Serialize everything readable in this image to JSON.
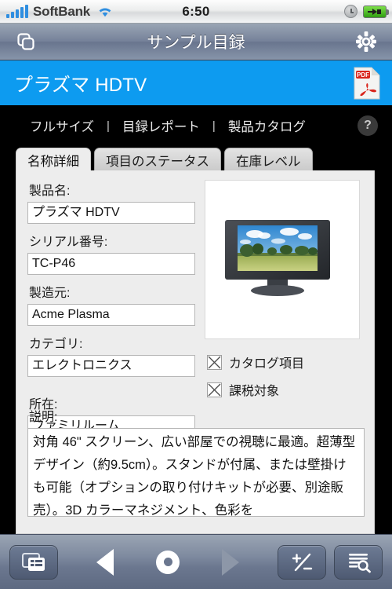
{
  "status_bar": {
    "carrier": "SoftBank",
    "time": "6:50",
    "signal_icon": "signal-bars-icon",
    "wifi_icon": "wifi-icon",
    "alarm_icon": "alarm-clock-icon",
    "battery_icon": "battery-charging-icon"
  },
  "nav_bar": {
    "title": "サンプル目録",
    "left_icon": "layers-copy-icon",
    "right_icon": "gear-icon"
  },
  "record_header": {
    "title": "プラズマ HDTV",
    "pdf_icon": "pdf-document-icon",
    "accent_color": "#0d9bf0"
  },
  "link_toolbar": {
    "links": [
      "フルサイズ",
      "目録レポート",
      "製品カタログ"
    ],
    "separator": "|",
    "help_label": "?"
  },
  "tabs": [
    {
      "label": "名称詳細",
      "active": true
    },
    {
      "label": "項目のステータス",
      "active": false
    },
    {
      "label": "在庫レベル",
      "active": false
    }
  ],
  "form": {
    "fields": [
      {
        "label": "製品名:",
        "value": "プラズマ HDTV"
      },
      {
        "label": "シリアル番号:",
        "value": "TC-P46"
      },
      {
        "label": "製造元:",
        "value": "Acme Plasma"
      },
      {
        "label": "カテゴリ:",
        "value": "エレクトロニクス"
      },
      {
        "label": "所在:",
        "value": "ファミリルーム"
      }
    ],
    "checkboxes": [
      {
        "label": "カタログ項目",
        "checked": true
      },
      {
        "label": "課税対象",
        "checked": true
      }
    ],
    "description": {
      "label": "説明:",
      "value": "対角 46\" スクリーン、広い部屋での視聴に最適。超薄型デザイン（約9.5cm）。スタンドが付属、または壁掛けも可能（オプションの取り付けキットが必要、別途販売）。3D カラーマネジメント、色彩を"
    },
    "thumbnail": {
      "icon": "product-photo-flatscreen-tv"
    }
  },
  "bottom_toolbar": {
    "buttons": [
      {
        "name": "layout-list-button",
        "icon": "window-list-icon"
      },
      {
        "name": "previous-record-button",
        "icon": "triangle-left-icon"
      },
      {
        "name": "record-indicator",
        "icon": "record-circle-icon"
      },
      {
        "name": "next-record-button",
        "icon": "triangle-right-icon"
      },
      {
        "name": "new-delete-record-button",
        "icon": "plus-minus-icon"
      },
      {
        "name": "find-records-button",
        "icon": "list-search-icon"
      }
    ]
  }
}
